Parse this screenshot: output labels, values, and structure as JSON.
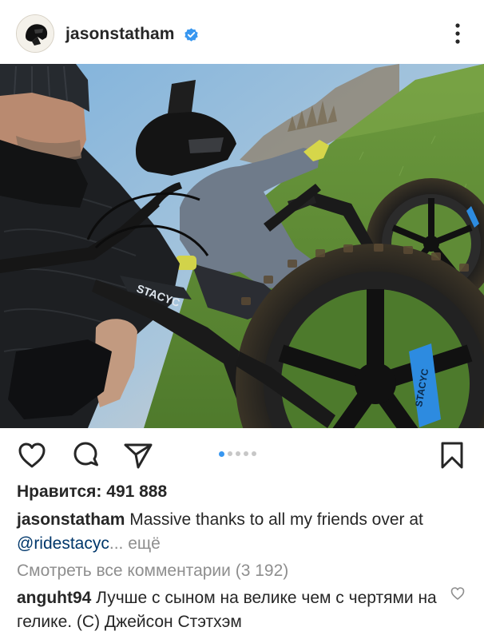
{
  "header": {
    "username": "jasonstatham",
    "verified_icon": "verified-badge-icon",
    "more_icon": "more-vertical-icon"
  },
  "post": {
    "image_alt": "Selfie of a man in a black beanie and puffer jacket with a child in a black helmet and grey jacket on a bike on a grassy field",
    "carousel": {
      "count": 5,
      "active_index": 0
    }
  },
  "actions": {
    "like_icon": "heart-icon",
    "comment_icon": "comment-icon",
    "share_icon": "send-icon",
    "save_icon": "bookmark-icon"
  },
  "likes": "Нравится: 491 888",
  "caption": {
    "username": "jasonstatham",
    "text_line1": " Massive thanks to all my friends over at",
    "mention": "@ridestacyc",
    "ellipsis": "...",
    "more": " ещё"
  },
  "view_comments": "Смотреть все комментарии (3 192)",
  "comment": {
    "username": "anguht94",
    "text": " Лучше с сыном на велике чем с чертями на гелике. (С) Джейсон Стэтхэм",
    "like_icon": "heart-outline-small-icon"
  },
  "colors": {
    "text": "#262626",
    "secondary": "#8e8e8e",
    "link": "#00376b",
    "accent": "#3897f0"
  }
}
